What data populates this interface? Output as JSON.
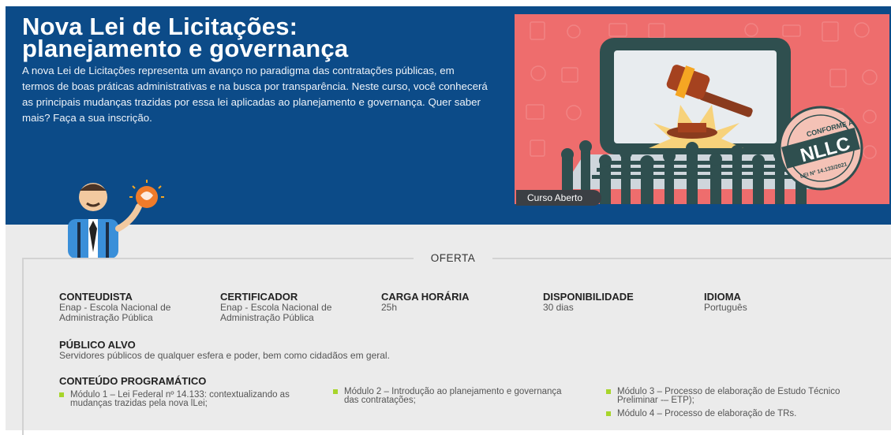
{
  "hero": {
    "title_line1": "Nova Lei de Licitações:",
    "title_line2": "planejamento e governança",
    "description": "A nova Lei de Licitações representa um avanço no paradigma das contratações públicas, em termos de boas práticas administrativas e na busca por transparência. Neste curso, você conhecerá as principais mudanças trazidas por essa lei aplicadas ao planejamento e governança. Quer saber mais? Faça a sua inscrição.",
    "badge": "Curso Aberto",
    "seal_line1": "CONFORME A",
    "seal_main": "NLLC",
    "seal_line2": "LEI Nº 14.133/2021"
  },
  "oferta": {
    "heading": "OFERTA",
    "conteudista_label": "CONTEUDISTA",
    "conteudista_value": "Enap - Escola Nacional de Administração Pública",
    "certificador_label": "CERTIFICADOR",
    "certificador_value": "Enap - Escola Nacional de Administração Pública",
    "carga_label": "CARGA HORÁRIA",
    "carga_value": "25h",
    "disponibilidade_label": "DISPONIBILIDADE",
    "disponibilidade_value": "30 dias",
    "idioma_label": "IDIOMA",
    "idioma_value": "Português",
    "publico_label": "PÚBLICO ALVO",
    "publico_value": "Servidores públicos de qualquer esfera e poder, bem como cidadãos em geral.",
    "conteudo_label": "CONTEÚDO PROGRAMÁTICO",
    "modules": [
      "Módulo 1 – Lei Federal nº 14.133: contextualizando as mudanças trazidas pela nova lLei;",
      "Módulo 2 – Introdução ao planejamento e governança das contratações;",
      "Módulo 3 – Processo de elaboração de Estudo Técnico Preliminar -– ETP);",
      "Módulo 4 – Processo de elaboração de TRs."
    ]
  },
  "colors": {
    "hero_bg": "#0c4b88",
    "image_bg": "#ee6d6d",
    "bullet": "#a7d52b",
    "section_bg": "#ebebeb"
  },
  "icons": [
    "gavel-icon",
    "laptop-icon",
    "raised-hands-icon",
    "seal-icon",
    "mascot-illustration",
    "hand-globe-icon"
  ]
}
